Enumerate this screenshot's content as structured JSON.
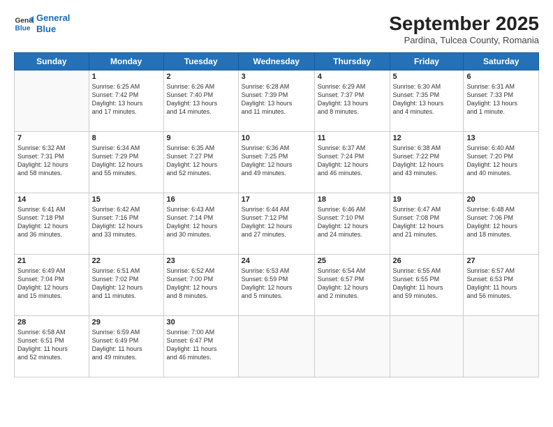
{
  "logo": {
    "line1": "General",
    "line2": "Blue"
  },
  "header": {
    "month": "September 2025",
    "location": "Pardina, Tulcea County, Romania"
  },
  "days_of_week": [
    "Sunday",
    "Monday",
    "Tuesday",
    "Wednesday",
    "Thursday",
    "Friday",
    "Saturday"
  ],
  "weeks": [
    [
      {
        "day": "",
        "info": ""
      },
      {
        "day": "1",
        "info": "Sunrise: 6:25 AM\nSunset: 7:42 PM\nDaylight: 13 hours\nand 17 minutes."
      },
      {
        "day": "2",
        "info": "Sunrise: 6:26 AM\nSunset: 7:40 PM\nDaylight: 13 hours\nand 14 minutes."
      },
      {
        "day": "3",
        "info": "Sunrise: 6:28 AM\nSunset: 7:39 PM\nDaylight: 13 hours\nand 11 minutes."
      },
      {
        "day": "4",
        "info": "Sunrise: 6:29 AM\nSunset: 7:37 PM\nDaylight: 13 hours\nand 8 minutes."
      },
      {
        "day": "5",
        "info": "Sunrise: 6:30 AM\nSunset: 7:35 PM\nDaylight: 13 hours\nand 4 minutes."
      },
      {
        "day": "6",
        "info": "Sunrise: 6:31 AM\nSunset: 7:33 PM\nDaylight: 13 hours\nand 1 minute."
      }
    ],
    [
      {
        "day": "7",
        "info": "Sunrise: 6:32 AM\nSunset: 7:31 PM\nDaylight: 12 hours\nand 58 minutes."
      },
      {
        "day": "8",
        "info": "Sunrise: 6:34 AM\nSunset: 7:29 PM\nDaylight: 12 hours\nand 55 minutes."
      },
      {
        "day": "9",
        "info": "Sunrise: 6:35 AM\nSunset: 7:27 PM\nDaylight: 12 hours\nand 52 minutes."
      },
      {
        "day": "10",
        "info": "Sunrise: 6:36 AM\nSunset: 7:25 PM\nDaylight: 12 hours\nand 49 minutes."
      },
      {
        "day": "11",
        "info": "Sunrise: 6:37 AM\nSunset: 7:24 PM\nDaylight: 12 hours\nand 46 minutes."
      },
      {
        "day": "12",
        "info": "Sunrise: 6:38 AM\nSunset: 7:22 PM\nDaylight: 12 hours\nand 43 minutes."
      },
      {
        "day": "13",
        "info": "Sunrise: 6:40 AM\nSunset: 7:20 PM\nDaylight: 12 hours\nand 40 minutes."
      }
    ],
    [
      {
        "day": "14",
        "info": "Sunrise: 6:41 AM\nSunset: 7:18 PM\nDaylight: 12 hours\nand 36 minutes."
      },
      {
        "day": "15",
        "info": "Sunrise: 6:42 AM\nSunset: 7:16 PM\nDaylight: 12 hours\nand 33 minutes."
      },
      {
        "day": "16",
        "info": "Sunrise: 6:43 AM\nSunset: 7:14 PM\nDaylight: 12 hours\nand 30 minutes."
      },
      {
        "day": "17",
        "info": "Sunrise: 6:44 AM\nSunset: 7:12 PM\nDaylight: 12 hours\nand 27 minutes."
      },
      {
        "day": "18",
        "info": "Sunrise: 6:46 AM\nSunset: 7:10 PM\nDaylight: 12 hours\nand 24 minutes."
      },
      {
        "day": "19",
        "info": "Sunrise: 6:47 AM\nSunset: 7:08 PM\nDaylight: 12 hours\nand 21 minutes."
      },
      {
        "day": "20",
        "info": "Sunrise: 6:48 AM\nSunset: 7:06 PM\nDaylight: 12 hours\nand 18 minutes."
      }
    ],
    [
      {
        "day": "21",
        "info": "Sunrise: 6:49 AM\nSunset: 7:04 PM\nDaylight: 12 hours\nand 15 minutes."
      },
      {
        "day": "22",
        "info": "Sunrise: 6:51 AM\nSunset: 7:02 PM\nDaylight: 12 hours\nand 11 minutes."
      },
      {
        "day": "23",
        "info": "Sunrise: 6:52 AM\nSunset: 7:00 PM\nDaylight: 12 hours\nand 8 minutes."
      },
      {
        "day": "24",
        "info": "Sunrise: 6:53 AM\nSunset: 6:59 PM\nDaylight: 12 hours\nand 5 minutes."
      },
      {
        "day": "25",
        "info": "Sunrise: 6:54 AM\nSunset: 6:57 PM\nDaylight: 12 hours\nand 2 minutes."
      },
      {
        "day": "26",
        "info": "Sunrise: 6:55 AM\nSunset: 6:55 PM\nDaylight: 11 hours\nand 59 minutes."
      },
      {
        "day": "27",
        "info": "Sunrise: 6:57 AM\nSunset: 6:53 PM\nDaylight: 11 hours\nand 56 minutes."
      }
    ],
    [
      {
        "day": "28",
        "info": "Sunrise: 6:58 AM\nSunset: 6:51 PM\nDaylight: 11 hours\nand 52 minutes."
      },
      {
        "day": "29",
        "info": "Sunrise: 6:59 AM\nSunset: 6:49 PM\nDaylight: 11 hours\nand 49 minutes."
      },
      {
        "day": "30",
        "info": "Sunrise: 7:00 AM\nSunset: 6:47 PM\nDaylight: 11 hours\nand 46 minutes."
      },
      {
        "day": "",
        "info": ""
      },
      {
        "day": "",
        "info": ""
      },
      {
        "day": "",
        "info": ""
      },
      {
        "day": "",
        "info": ""
      }
    ]
  ]
}
